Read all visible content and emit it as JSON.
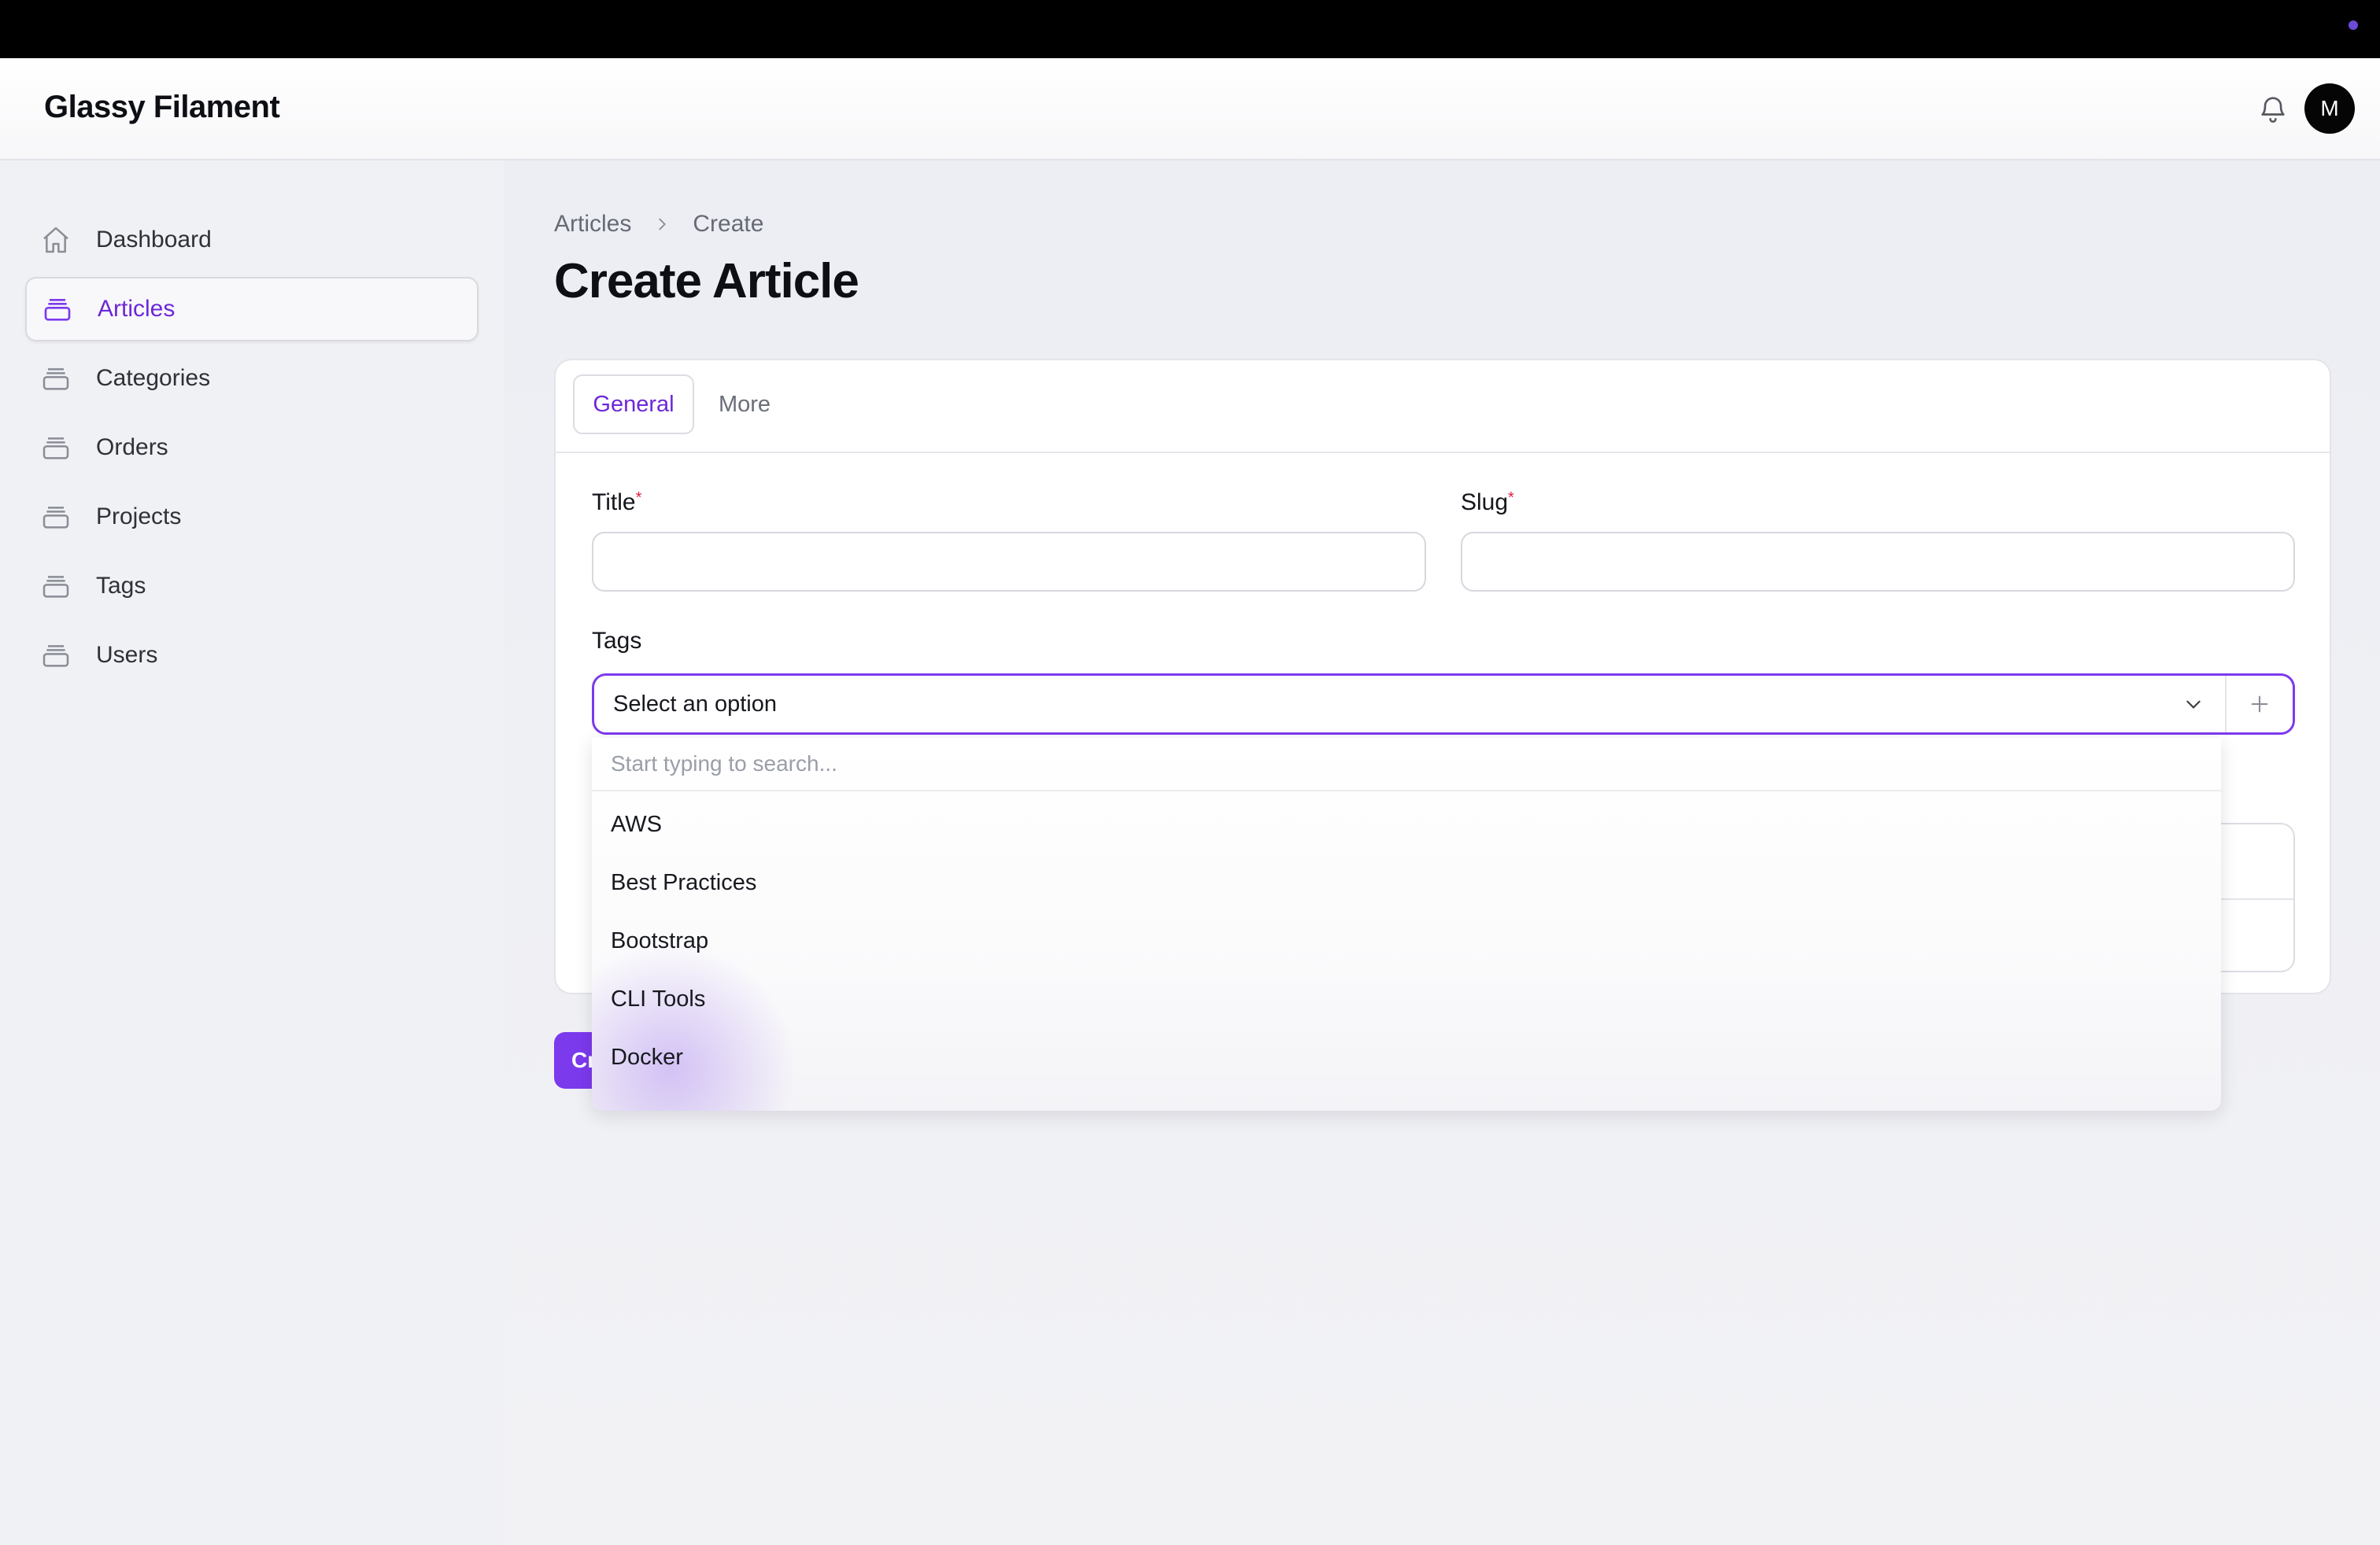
{
  "app": {
    "brand": "Glassy Filament",
    "user_initial": "M"
  },
  "sidebar": {
    "items": [
      {
        "label": "Dashboard",
        "icon": "home-icon",
        "active": false
      },
      {
        "label": "Articles",
        "icon": "collection-icon",
        "active": true
      },
      {
        "label": "Categories",
        "icon": "collection-icon",
        "active": false
      },
      {
        "label": "Orders",
        "icon": "collection-icon",
        "active": false
      },
      {
        "label": "Projects",
        "icon": "collection-icon",
        "active": false
      },
      {
        "label": "Tags",
        "icon": "collection-icon",
        "active": false
      },
      {
        "label": "Users",
        "icon": "collection-icon",
        "active": false
      }
    ]
  },
  "breadcrumb": {
    "items": [
      "Articles",
      "Create"
    ]
  },
  "page": {
    "title": "Create Article"
  },
  "form": {
    "tabs": [
      {
        "label": "General",
        "active": true
      },
      {
        "label": "More",
        "active": false
      }
    ],
    "title_field": {
      "label": "Title",
      "required_mark": "*",
      "value": ""
    },
    "slug_field": {
      "label": "Slug",
      "required_mark": "*",
      "value": ""
    },
    "tags_field": {
      "label": "Tags",
      "selected": "Select an option",
      "search_placeholder": "Start typing to search...",
      "options": [
        "AWS",
        "Best Practices",
        "Bootstrap",
        "CLI Tools",
        "Docker"
      ]
    },
    "create_button": "Cr"
  },
  "colors": {
    "accent": "#7c3aed",
    "accent_text": "#6d28d9",
    "required": "#e11d48"
  }
}
